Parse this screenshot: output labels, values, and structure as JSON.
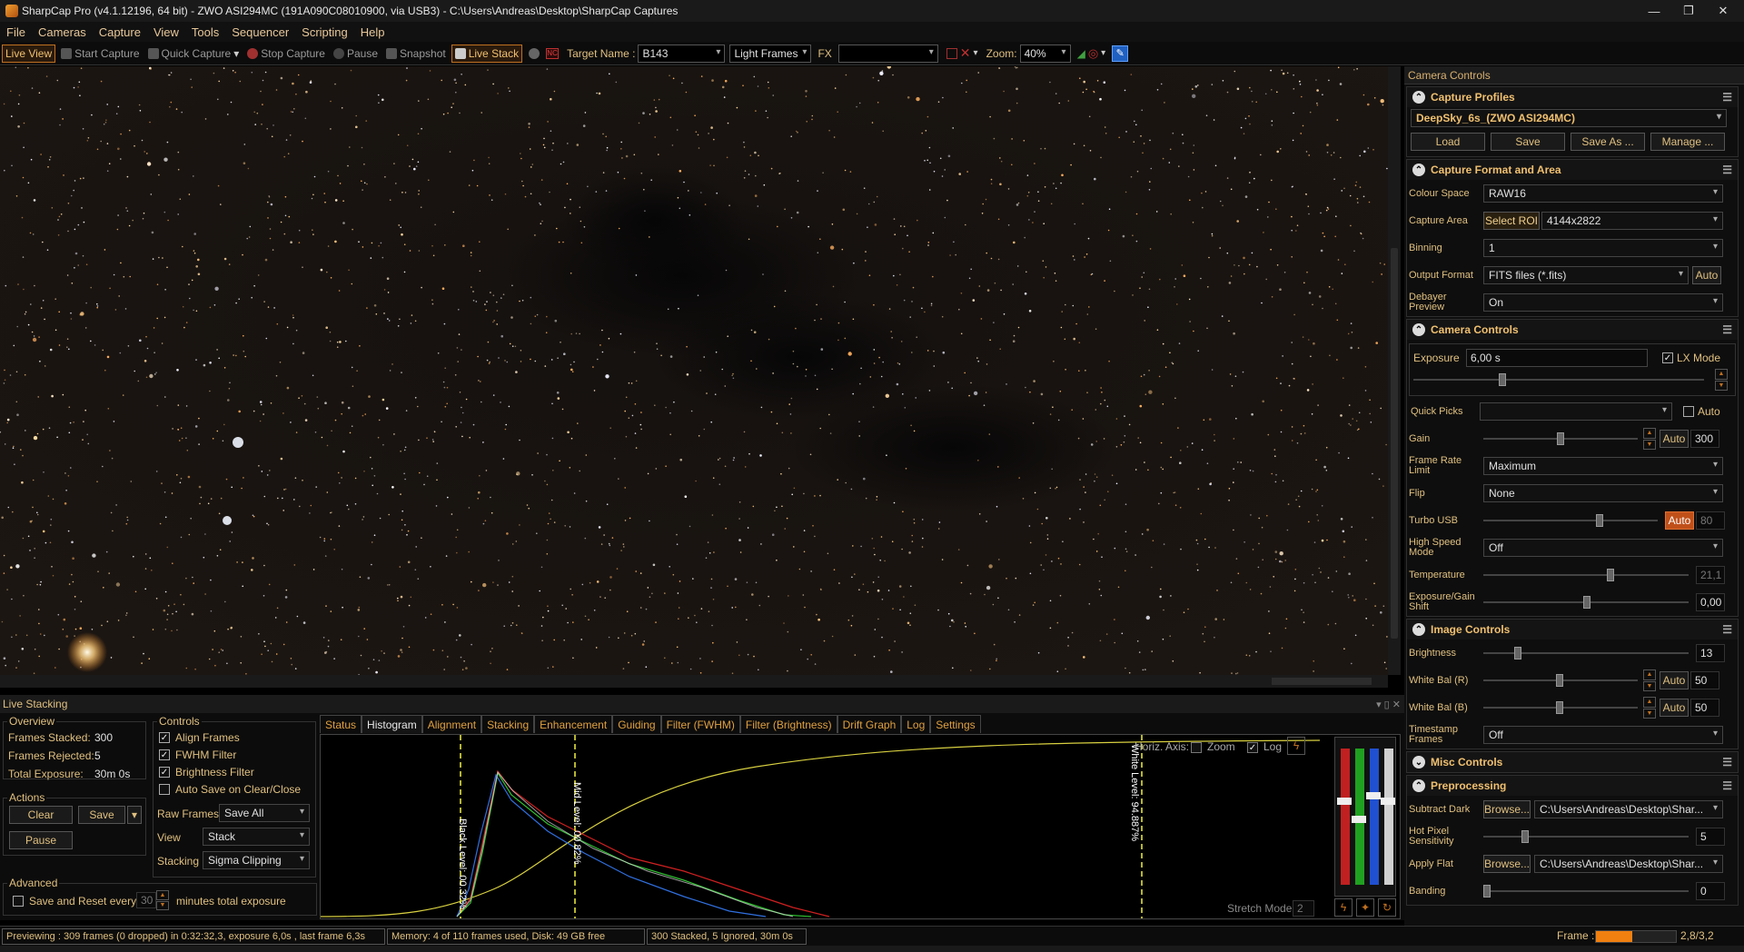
{
  "window": {
    "title": "SharpCap Pro (v4.1.12196, 64 bit) - ZWO ASI294MC (191A090C08010900, via USB3) - C:\\Users\\Andreas\\Desktop\\SharpCap Captures",
    "min": "—",
    "max": "❐",
    "close": "✕"
  },
  "menu": [
    "File",
    "Cameras",
    "Capture",
    "View",
    "Tools",
    "Sequencer",
    "Scripting",
    "Help"
  ],
  "toolbar": {
    "live_view": "Live View",
    "start_capture": "Start Capture",
    "quick_capture": "Quick Capture",
    "stop_capture": "Stop Capture",
    "pause": "Pause",
    "snapshot": "Snapshot",
    "live_stack": "Live Stack",
    "target_label": "Target Name :",
    "target_value": "B143",
    "frame_type": "Light Frames",
    "fx_label": "FX",
    "fx_value": "",
    "zoom_label": "Zoom:",
    "zoom_value": "40%"
  },
  "right_panel": {
    "title": "Camera Controls",
    "capture_profiles": {
      "title": "Capture Profiles",
      "profile": "DeepSky_6s_(ZWO ASI294MC)",
      "load": "Load",
      "save": "Save",
      "save_as": "Save As ...",
      "manage": "Manage ..."
    },
    "format_area": {
      "title": "Capture Format and Area",
      "colour_space_label": "Colour Space",
      "colour_space": "RAW16",
      "capture_area_label": "Capture Area",
      "select_roi": "Select ROI",
      "capture_area": "4144x2822",
      "binning_label": "Binning",
      "binning": "1",
      "output_format_label": "Output Format",
      "output_format": "FITS files (*.fits)",
      "auto": "Auto",
      "debayer_label": "Debayer Preview",
      "debayer": "On"
    },
    "camera_controls": {
      "title": "Camera Controls",
      "exposure_label": "Exposure",
      "exposure": "6,00 s",
      "lx_mode": "LX Mode",
      "quick_picks_label": "Quick Picks",
      "quick_picks": "",
      "quick_auto": "Auto",
      "gain_label": "Gain",
      "gain_auto": "Auto",
      "gain": "300",
      "gain_level": 0.5,
      "frame_rate_label": "Frame Rate Limit",
      "frame_rate": "Maximum",
      "flip_label": "Flip",
      "flip": "None",
      "turbo_label": "Turbo USB",
      "turbo_auto": "Auto",
      "turbo": "80",
      "high_speed_label": "High Speed Mode",
      "high_speed": "Off",
      "temperature_label": "Temperature",
      "temperature": "21,1",
      "exp_gain_label": "Exposure/Gain Shift",
      "exp_gain": "0,00"
    },
    "image_controls": {
      "title": "Image Controls",
      "brightness_label": "Brightness",
      "brightness": "13",
      "wb_r_label": "White Bal (R)",
      "wb_r_auto": "Auto",
      "wb_r": "50",
      "wb_b_label": "White Bal (B)",
      "wb_b_auto": "Auto",
      "wb_b": "50",
      "timestamp_label": "Timestamp Frames",
      "timestamp": "Off"
    },
    "misc_controls": {
      "title": "Misc Controls"
    },
    "preprocessing": {
      "title": "Preprocessing",
      "subtract_dark_label": "Subtract Dark",
      "browse": "Browse...",
      "dark_path": "C:\\Users\\Andreas\\Desktop\\Shar...",
      "hot_pixel_label": "Hot Pixel Sensitivity",
      "hot_pixel": "5",
      "apply_flat_label": "Apply Flat",
      "flat_path": "C:\\Users\\Andreas\\Desktop\\Shar...",
      "banding_label": "Banding",
      "banding": "0"
    }
  },
  "live_stacking": {
    "title": "Live Stacking",
    "overview": {
      "title": "Overview",
      "stacked_label": "Frames Stacked:",
      "stacked": "300",
      "rejected_label": "Frames Rejected:",
      "rejected": "5",
      "exposure_label": "Total Exposure:",
      "exposure": "30m 0s"
    },
    "actions": {
      "title": "Actions",
      "clear": "Clear",
      "save": "Save",
      "pause": "Pause"
    },
    "advanced": {
      "title": "Advanced",
      "save_reset": "Save and Reset every",
      "minutes": "30",
      "minutes_label": "minutes total exposure"
    },
    "controls": {
      "title": "Controls",
      "align": "Align Frames",
      "fwhm": "FWHM Filter",
      "brightness": "Brightness Filter",
      "autosave": "Auto Save on Clear/Close",
      "raw_frames_label": "Raw Frames",
      "raw_frames": "Save All",
      "view_label": "View",
      "view": "Stack",
      "stacking_label": "Stacking",
      "stacking": "Sigma Clipping"
    },
    "tabs": [
      "Status",
      "Histogram",
      "Alignment",
      "Stacking",
      "Enhancement",
      "Guiding",
      "Filter (FWHM)",
      "Filter (Brightness)",
      "Drift Graph",
      "Log",
      "Settings"
    ],
    "active_tab": 1,
    "histogram": {
      "horiz_axis": "Horiz. Axis:",
      "zoom": "Zoom",
      "log": "Log",
      "black_level": "Black Level: 00.32%",
      "mid_level": "Mid Level: 00.82%",
      "white_level": "White Level: 94.887%",
      "stretch_mode": "Stretch Mode",
      "stretch_value": "2"
    }
  },
  "status": {
    "preview": "Previewing : 309 frames (0 dropped) in 0:32:32,3, exposure 6,0s , last frame 6,3s",
    "memory": "Memory: 4 of 110 frames used, Disk: 49 GB free",
    "stack": "300 Stacked, 5 Ignored, 30m 0s",
    "frame_label": "Frame :",
    "frame_value": "2,8/3,2",
    "frame_progress": 0.45
  }
}
